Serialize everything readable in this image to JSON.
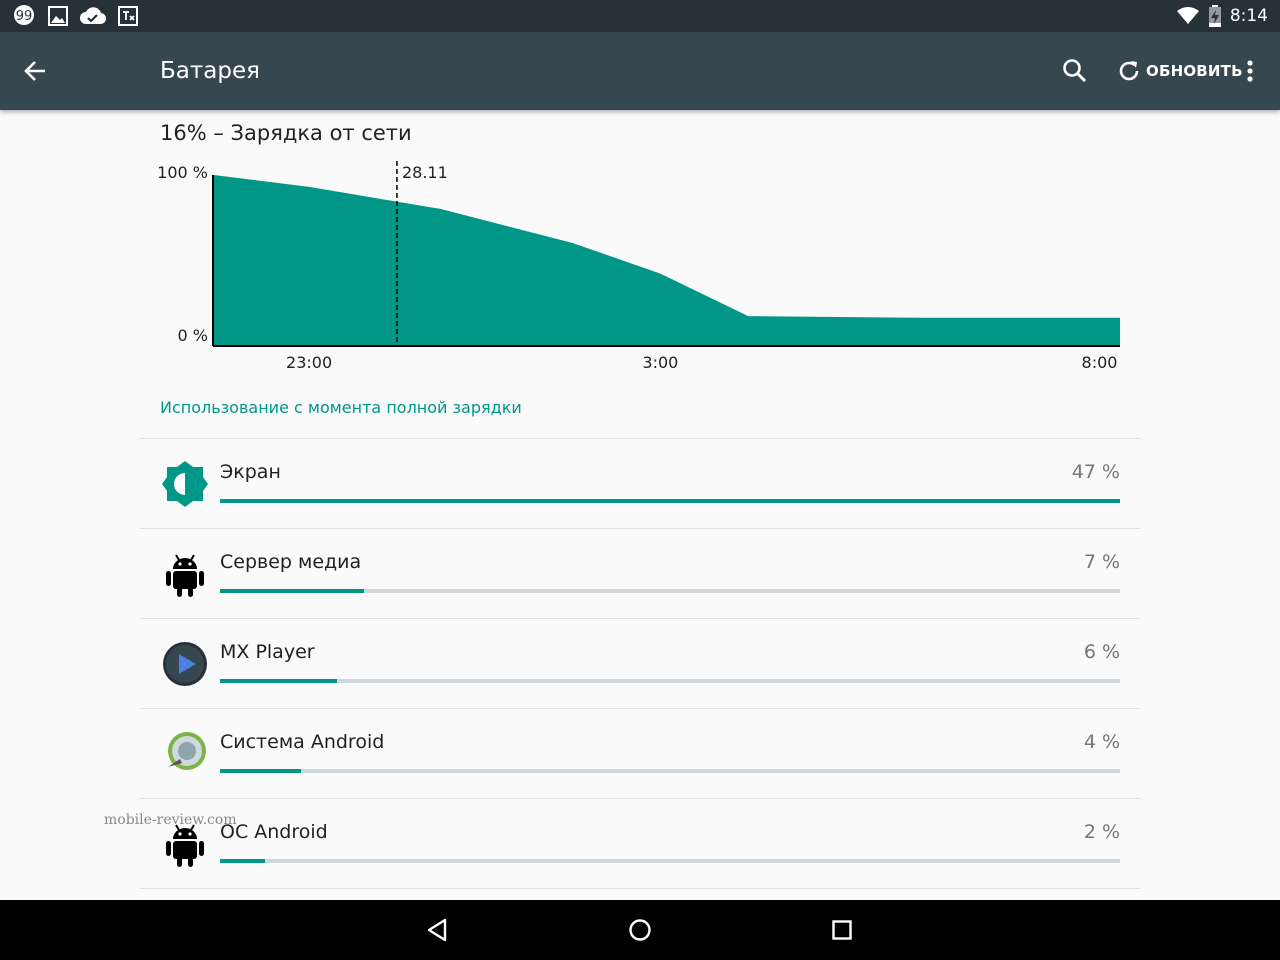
{
  "status_bar": {
    "time": "8:14"
  },
  "app_bar": {
    "title": "Батарея",
    "refresh_label": "ОБНОВИТЬ"
  },
  "battery": {
    "summary": "16% – Зарядка от сети"
  },
  "chart_data": {
    "type": "area",
    "x_ticks": [
      "23:00",
      "3:00",
      "8:00"
    ],
    "y_labels": [
      "100 %",
      "0 %"
    ],
    "marker_label": "28.11",
    "x": [
      "21:55",
      "23:00",
      "0:30",
      "2:00",
      "3:00",
      "4:00",
      "6:00",
      "8:00",
      "8:14"
    ],
    "values": [
      100,
      93,
      80,
      60,
      42,
      17,
      16,
      16,
      16
    ],
    "marker_x": "0:00",
    "ylim": [
      0,
      100
    ],
    "color": "#009688"
  },
  "usage": {
    "header": "Использование с момента полной зарядки",
    "items": [
      {
        "name": "Экран",
        "percent_label": "47 %",
        "fraction": 1.0,
        "icon": "brightness-icon"
      },
      {
        "name": "Сервер медиа",
        "percent_label": "7 %",
        "fraction": 0.16,
        "icon": "android-icon"
      },
      {
        "name": "MX Player",
        "percent_label": "6 %",
        "fraction": 0.13,
        "icon": "play-icon"
      },
      {
        "name": "Система Android",
        "percent_label": "4 %",
        "fraction": 0.09,
        "icon": "android-system-icon"
      },
      {
        "name": "ОС Android",
        "percent_label": "2 %",
        "fraction": 0.05,
        "icon": "android-icon"
      }
    ]
  },
  "watermark": "mobile-review.com"
}
